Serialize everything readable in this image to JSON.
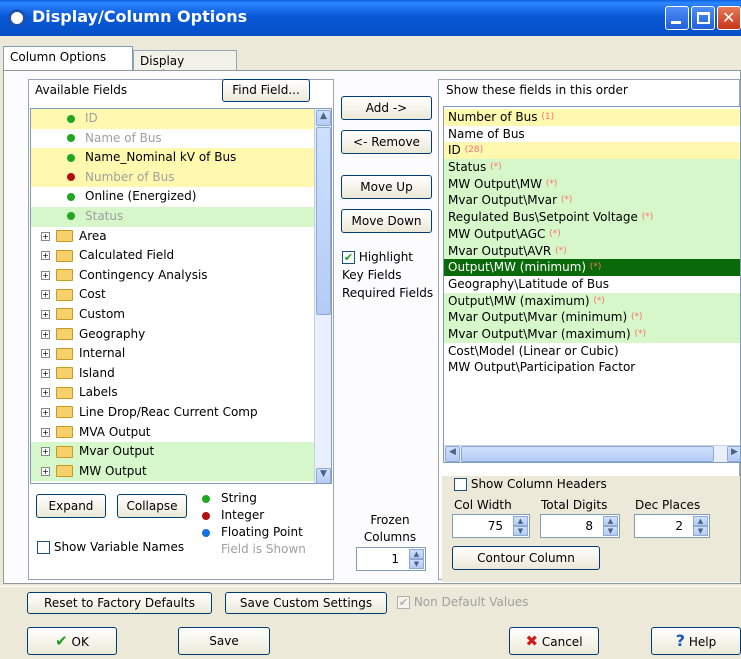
{
  "window": {
    "title": "Display/Column Options"
  },
  "tabs": [
    "Column Options",
    "Display Options"
  ],
  "left": {
    "header": "Available Fields",
    "find_button": "Find Field...",
    "fields": [
      {
        "label": "ID",
        "color": "#1fa81f",
        "grayed": true,
        "bg": "yellow"
      },
      {
        "label": "Name of Bus",
        "color": "#1fa81f",
        "grayed": true,
        "bg": "none"
      },
      {
        "label": "Name_Nominal kV of Bus",
        "color": "#1fa81f",
        "grayed": false,
        "bg": "yellow"
      },
      {
        "label": "Number of Bus",
        "color": "#b01010",
        "grayed": true,
        "bg": "yellow"
      },
      {
        "label": "Online (Energized)",
        "color": "#1fa81f",
        "grayed": false,
        "bg": "none"
      },
      {
        "label": "Status",
        "color": "#1fa81f",
        "grayed": true,
        "bg": "green"
      }
    ],
    "folders": [
      {
        "label": "Area",
        "bg": "none"
      },
      {
        "label": "Calculated Field",
        "bg": "none"
      },
      {
        "label": "Contingency Analysis",
        "bg": "none"
      },
      {
        "label": "Cost",
        "bg": "none"
      },
      {
        "label": "Custom",
        "bg": "none"
      },
      {
        "label": "Geography",
        "bg": "none"
      },
      {
        "label": "Internal",
        "bg": "none"
      },
      {
        "label": "Island",
        "bg": "none"
      },
      {
        "label": "Labels",
        "bg": "none"
      },
      {
        "label": "Line Drop/Reac Current Comp",
        "bg": "none"
      },
      {
        "label": "MVA Output",
        "bg": "none"
      },
      {
        "label": "Mvar Output",
        "bg": "green"
      },
      {
        "label": "MW Output",
        "bg": "green"
      }
    ],
    "expand": "Expand",
    "collapse": "Collapse",
    "show_variable_names": "Show Variable Names",
    "legend": [
      {
        "label": "String",
        "color": "#1fa81f"
      },
      {
        "label": "Integer",
        "color": "#b01010"
      },
      {
        "label": "Floating Point",
        "color": "#1570e0"
      },
      {
        "label": "Field is Shown",
        "color": ""
      }
    ]
  },
  "middle": {
    "add": "Add ->",
    "remove": "<- Remove",
    "move_up": "Move Up",
    "move_down": "Move Down",
    "highlight_lines": [
      "Highlight",
      "Key Fields",
      "Required Fields"
    ],
    "highlight_checked": true,
    "frozen_label_1": "Frozen",
    "frozen_label_2": "Columns",
    "frozen_value": "1"
  },
  "right": {
    "header": "Show these fields in this order",
    "fields": [
      {
        "label": "Number of Bus",
        "mark": "(1)",
        "bg": "yellow"
      },
      {
        "label": "Name of Bus",
        "mark": "",
        "bg": "none"
      },
      {
        "label": "ID",
        "mark": "(28)",
        "bg": "yellow"
      },
      {
        "label": "Status",
        "mark": "(*)",
        "bg": "green"
      },
      {
        "label": "MW Output\\MW",
        "mark": "(*)",
        "bg": "green"
      },
      {
        "label": "Mvar Output\\Mvar",
        "mark": "(*)",
        "bg": "green"
      },
      {
        "label": "Regulated Bus\\Setpoint Voltage",
        "mark": "(*)",
        "bg": "green"
      },
      {
        "label": "MW Output\\AGC",
        "mark": "(*)",
        "bg": "green"
      },
      {
        "label": "Mvar Output\\AVR",
        "mark": "(*)",
        "bg": "green"
      },
      {
        "label": "Output\\MW (minimum)",
        "mark": "(*)",
        "bg": "sel"
      },
      {
        "label": "Geography\\Latitude of Bus",
        "mark": "",
        "bg": "none"
      },
      {
        "label": "Output\\MW (maximum)",
        "mark": "(*)",
        "bg": "green"
      },
      {
        "label": "Mvar Output\\Mvar (minimum)",
        "mark": "(*)",
        "bg": "green"
      },
      {
        "label": "Mvar Output\\Mvar (maximum)",
        "mark": "(*)",
        "bg": "green"
      },
      {
        "label": "Cost\\Model (Linear or Cubic)",
        "mark": "",
        "bg": "none"
      },
      {
        "label": "MW Output\\Participation Factor",
        "mark": "",
        "bg": "none"
      }
    ],
    "show_column_headers": "Show Column Headers",
    "col_width_label": "Col Width",
    "total_digits_label": "Total Digits",
    "dec_places_label": "Dec Places",
    "col_width": "75",
    "total_digits": "8",
    "dec_places": "2",
    "contour_button": "Contour Column"
  },
  "footer": {
    "reset": "Reset to Factory Defaults",
    "save_custom": "Save Custom Settings",
    "non_default": "Non Default Values",
    "ok": "OK",
    "save": "Save",
    "cancel": "Cancel",
    "help": "Help"
  }
}
